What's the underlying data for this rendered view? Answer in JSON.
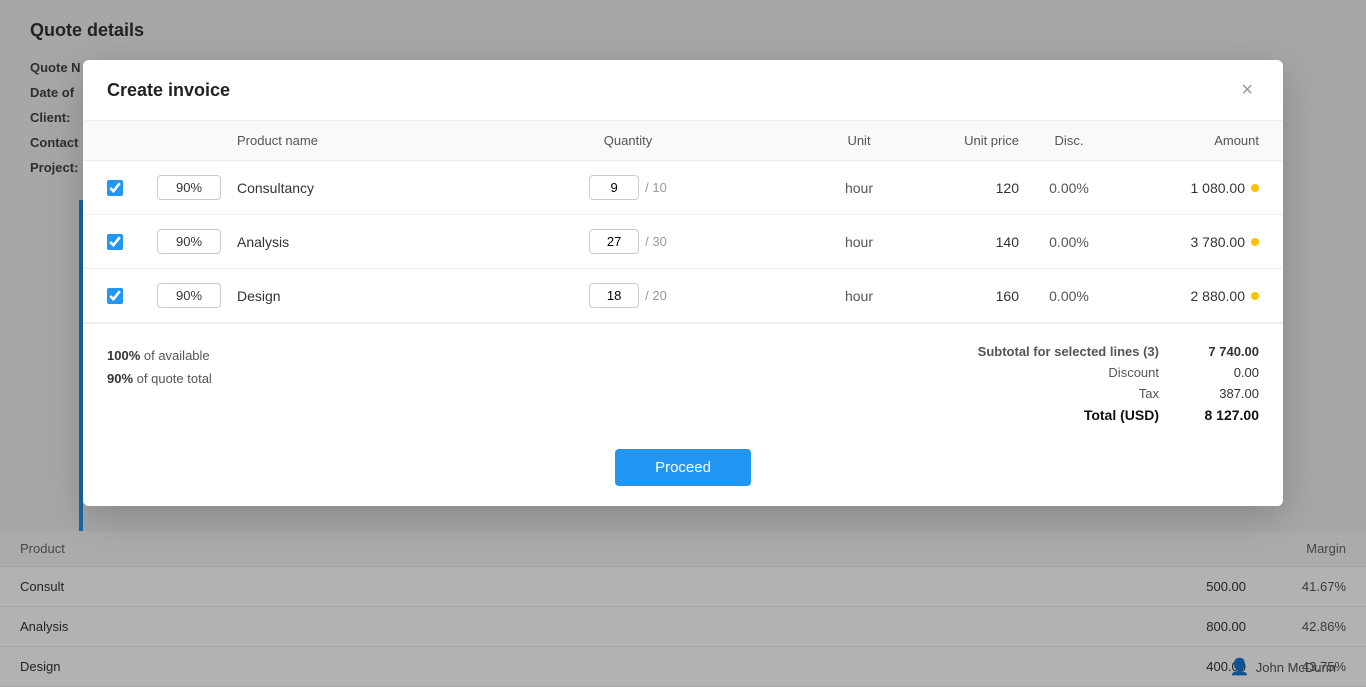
{
  "page": {
    "title": "Quote details",
    "fields": [
      {
        "label": "Quote N",
        "value": ""
      },
      {
        "label": "Date of",
        "value": ""
      },
      {
        "label": "Client:",
        "value": ""
      },
      {
        "label": "Contact",
        "value": ""
      },
      {
        "label": "Project:",
        "value": ""
      }
    ]
  },
  "modal": {
    "title": "Create invoice",
    "close_label": "×",
    "columns": {
      "check": "",
      "pct": "",
      "product_name": "Product name",
      "quantity": "Quantity",
      "unit": "Unit",
      "unit_price": "Unit price",
      "disc": "Disc.",
      "amount": "Amount"
    },
    "rows": [
      {
        "checked": true,
        "pct": "90%",
        "product": "Consultancy",
        "qty": "9",
        "qty_max": "10",
        "unit": "hour",
        "unit_price": "120",
        "disc": "0.00%",
        "amount": "1 080.00"
      },
      {
        "checked": true,
        "pct": "90%",
        "product": "Analysis",
        "qty": "27",
        "qty_max": "30",
        "unit": "hour",
        "unit_price": "140",
        "disc": "0.00%",
        "amount": "3 780.00"
      },
      {
        "checked": true,
        "pct": "90%",
        "product": "Design",
        "qty": "18",
        "qty_max": "20",
        "unit": "hour",
        "unit_price": "160",
        "disc": "0.00%",
        "amount": "2 880.00"
      }
    ],
    "footer": {
      "available_pct": "100%",
      "available_label": "of available",
      "quote_pct": "90%",
      "quote_label": "of quote total",
      "subtotal_label": "Subtotal for selected lines (3)",
      "subtotal_value": "7 740.00",
      "discount_label": "Discount",
      "discount_value": "0.00",
      "tax_label": "Tax",
      "tax_value": "387.00",
      "total_label": "Total (USD)",
      "total_value": "8 127.00"
    },
    "proceed_label": "Proceed"
  },
  "background": {
    "product_rows": [
      {
        "name": "Consult",
        "amount": "500.00",
        "margin": "41.67%"
      },
      {
        "name": "Analysis",
        "amount": "800.00",
        "margin": "42.86%"
      },
      {
        "name": "Design",
        "amount": "400.00",
        "margin": "43.75%"
      }
    ],
    "user": "John McDunn",
    "columns": {
      "product": "Product",
      "margin": "Margin"
    }
  }
}
